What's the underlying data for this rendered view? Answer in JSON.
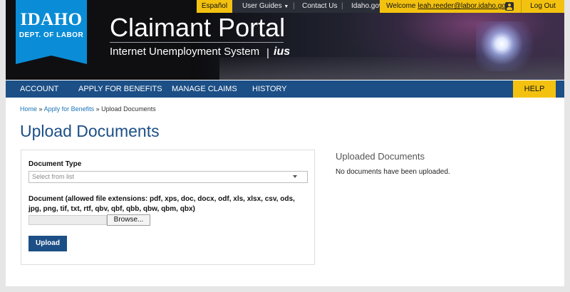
{
  "utility": {
    "espanol": "Español",
    "user_guides": "User Guides",
    "contact_us": "Contact Us",
    "idaho_gov": "Idaho.gov",
    "welcome_prefix": "Welcome",
    "user_email": "leah.reeder@labor.idaho.gov",
    "logout": "Log Out",
    "sep1": "|",
    "sep2": "|"
  },
  "logo": {
    "line1": "IDAHO",
    "line2": "DEPT. OF LABOR"
  },
  "header": {
    "title": "Claimant Portal",
    "subtitle": "Internet Unemployment System",
    "bar": "|",
    "abbr": "ius"
  },
  "nav": {
    "items": [
      {
        "label": "ACCOUNT"
      },
      {
        "label": "APPLY FOR BENEFITS"
      },
      {
        "label": "MANAGE CLAIMS"
      },
      {
        "label": "HISTORY"
      }
    ],
    "help": "HELP"
  },
  "breadcrumb": {
    "home": "Home",
    "apply": "Apply for Benefits",
    "current": "Upload Documents",
    "sep": "»"
  },
  "page": {
    "title": "Upload Documents"
  },
  "form": {
    "doc_type_label": "Document Type",
    "doc_type_placeholder": "Select from list",
    "document_label": "Document (allowed file extensions: pdf, xps, doc, docx, odf, xls, xlsx, csv, ods, jpg, png, tif, txt, rtf, qbv, qbf, qbb, qbw, qbm, qbx)",
    "browse": "Browse...",
    "upload": "Upload"
  },
  "uploaded": {
    "title": "Uploaded Documents",
    "empty": "No documents have been uploaded."
  },
  "colors": {
    "nav_blue": "#1c4f86",
    "accent_yellow": "#f3c210",
    "logo_blue": "#0a8cd6",
    "link_blue": "#1a74b8"
  }
}
